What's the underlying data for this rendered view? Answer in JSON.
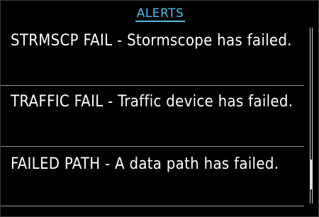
{
  "header": {
    "title": "ALERTS"
  },
  "alerts": [
    {
      "message": "STRMSCP FAIL - Stormscope has failed."
    },
    {
      "message": "TRAFFIC FAIL - Traffic device has failed."
    },
    {
      "message": "FAILED PATH - A data path has failed."
    }
  ],
  "scrollbar": {
    "thumb_start_fraction": 0.75,
    "thumb_end_fraction": 0.92
  },
  "colors": {
    "background": "#000000",
    "header_text": "#52bde6",
    "alert_text": "#ffffff",
    "divider": "#9a9a9a"
  }
}
